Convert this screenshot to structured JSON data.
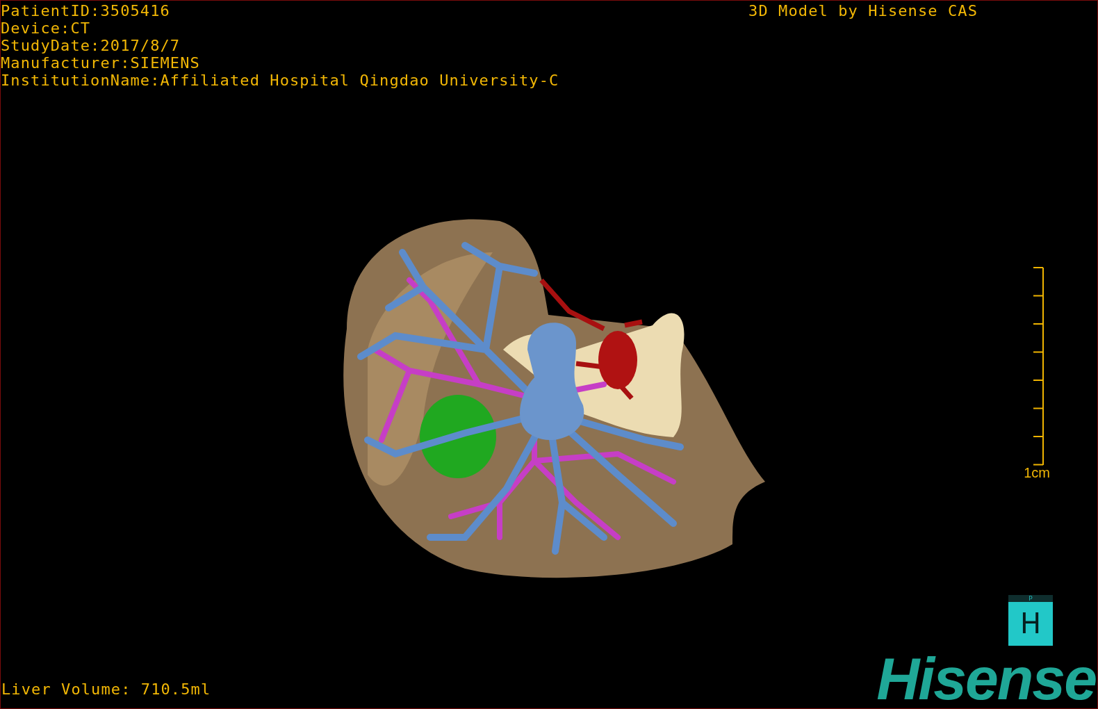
{
  "viewport": {
    "info_lines": [
      "PatientID:3505416",
      "Device:CT",
      "StudyDate:2017/8/7",
      "Manufacturer:SIEMENS",
      "InstitutionName:Affiliated Hospital Qingdao University-C"
    ],
    "title": "3D Model by Hisense CAS",
    "scale_bar": {
      "label": "1cm"
    },
    "orientation_cube": {
      "front": "H",
      "top": "P"
    },
    "logo": "Hisense",
    "volume": "Liver Volume: 710.5ml"
  }
}
